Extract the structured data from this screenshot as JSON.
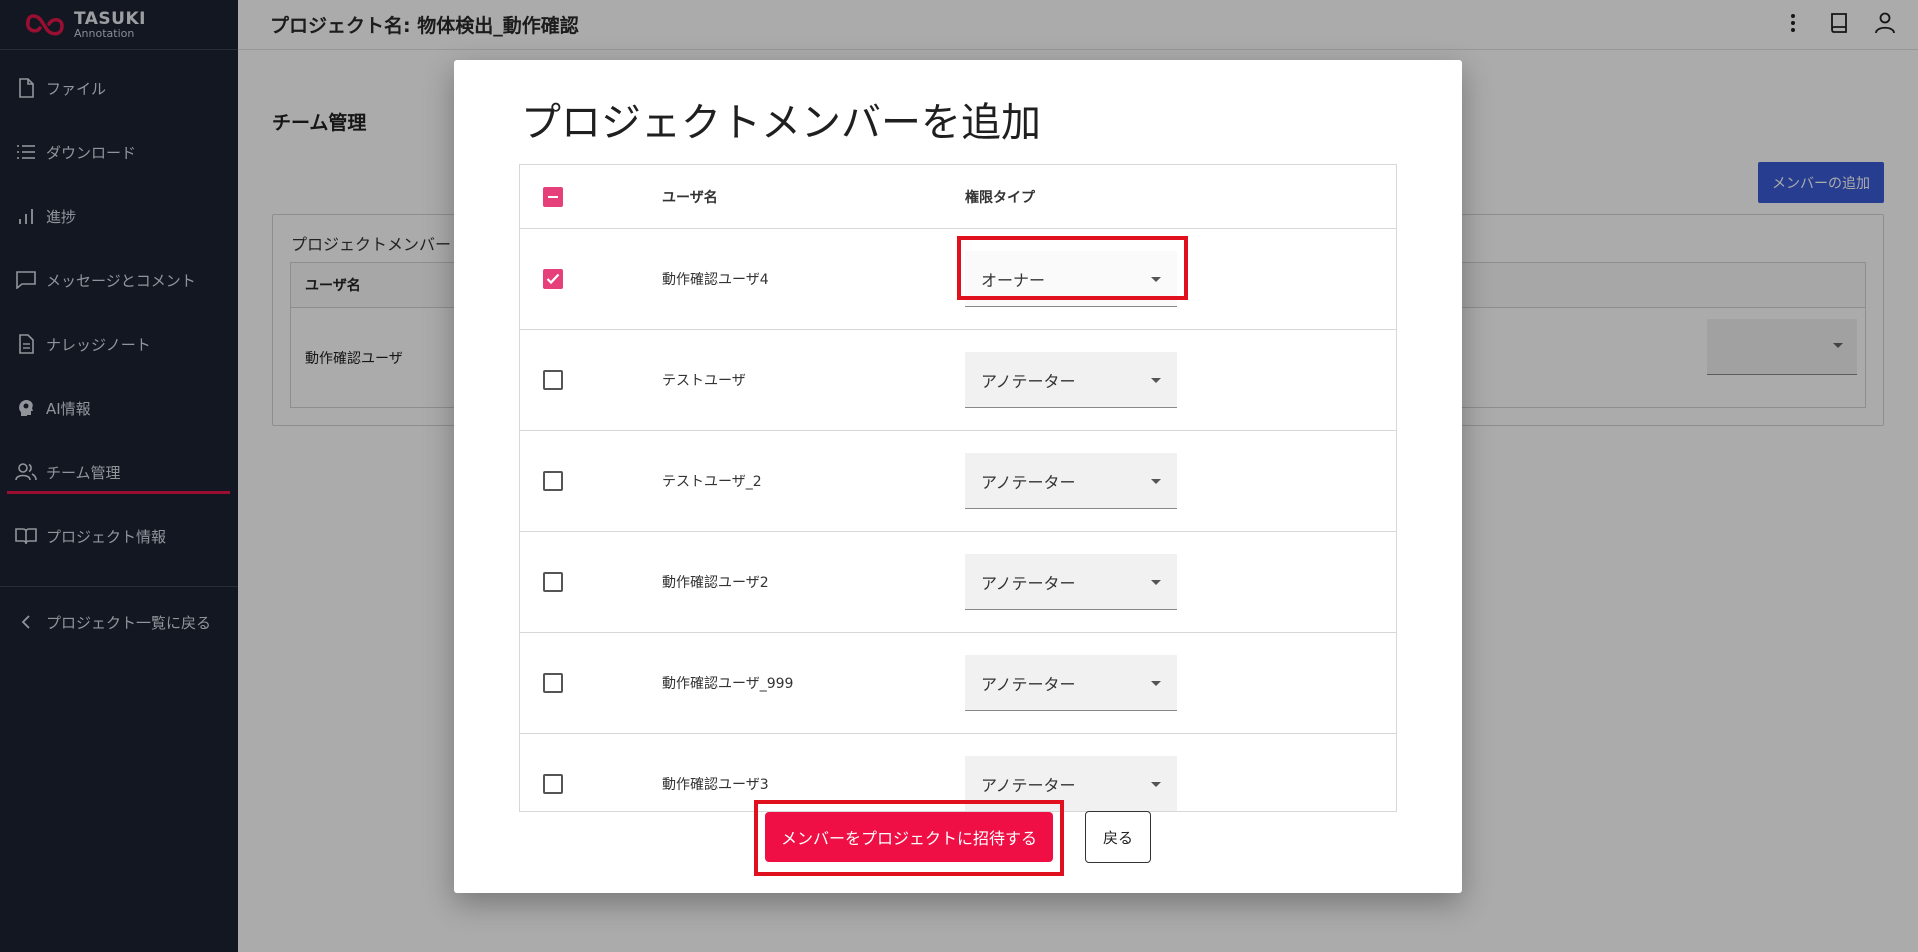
{
  "brand": {
    "name": "TASUKI",
    "sub": "Annotation"
  },
  "sidebar": {
    "items": [
      {
        "label": "ファイル",
        "icon": "file-icon"
      },
      {
        "label": "ダウンロード",
        "icon": "list-icon"
      },
      {
        "label": "進捗",
        "icon": "bar-chart-icon"
      },
      {
        "label": "メッセージとコメント",
        "icon": "message-icon"
      },
      {
        "label": "ナレッジノート",
        "icon": "document-icon"
      },
      {
        "label": "AI情報",
        "icon": "ai-head-icon"
      },
      {
        "label": "チーム管理",
        "icon": "team-icon",
        "active": true
      },
      {
        "label": "プロジェクト情報",
        "icon": "book-icon"
      }
    ],
    "back": {
      "label": "プロジェクト一覧に戻る",
      "icon": "chevron-left-icon"
    }
  },
  "header": {
    "project_title": "プロジェクト名: 物体検出_動作確認"
  },
  "page": {
    "heading": "チーム管理",
    "add_member_label": "メンバーの追加",
    "card_title": "プロジェクトメンバー",
    "table_header": "ユーザ名",
    "table_row": "動作確認ユーザ"
  },
  "modal": {
    "title": "プロジェクトメンバーを追加",
    "columns": {
      "user": "ユーザ名",
      "role": "権限タイプ"
    },
    "rows": [
      {
        "name": "動作確認ユーザ4",
        "role": "オーナー",
        "checked": true
      },
      {
        "name": "テストユーザ",
        "role": "アノテーター",
        "checked": false
      },
      {
        "name": "テストユーザ_2",
        "role": "アノテーター",
        "checked": false
      },
      {
        "name": "動作確認ユーザ2",
        "role": "アノテーター",
        "checked": false
      },
      {
        "name": "動作確認ユーザ_999",
        "role": "アノテーター",
        "checked": false
      },
      {
        "name": "動作確認ユーザ3",
        "role": "アノテーター",
        "checked": false
      }
    ],
    "invite_label": "メンバーをプロジェクトに招待する",
    "back_label": "戻る"
  },
  "colors": {
    "sidebar": "#1c2333",
    "accent": "#ef0f45",
    "primary": "#3b5bd6",
    "highlight": "#e0101e"
  }
}
